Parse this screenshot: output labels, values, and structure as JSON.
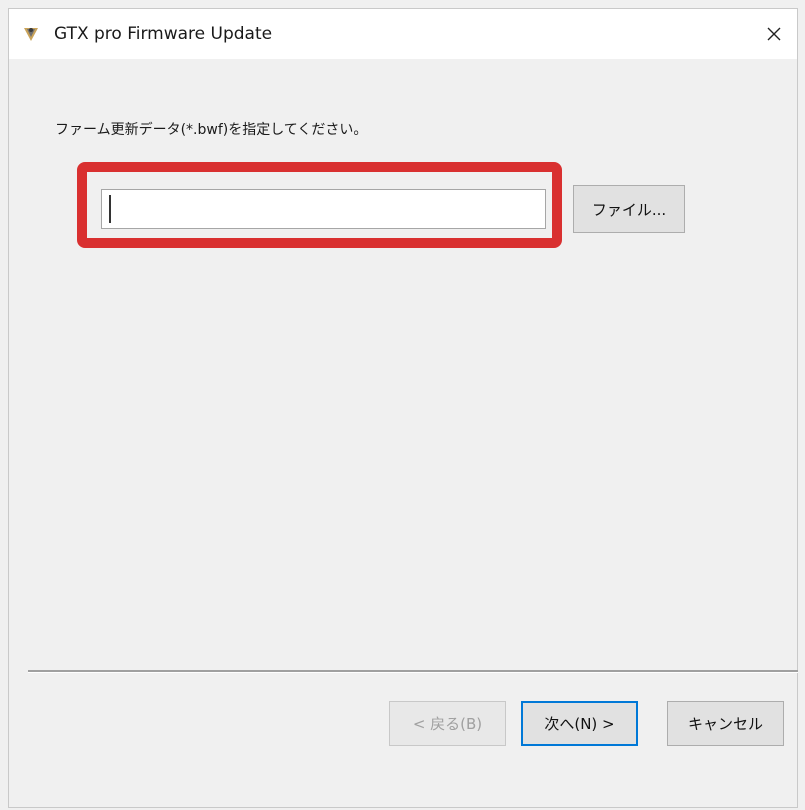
{
  "window": {
    "title": "GTX pro Firmware Update",
    "icon": "app-icon"
  },
  "content": {
    "instruction": "ファーム更新データ(*.bwf)を指定してください。",
    "file_path_value": "",
    "file_path_placeholder": "",
    "file_button_label": "ファイル..."
  },
  "footer": {
    "back_label": "< 戻る(B)",
    "next_label": "次へ(N) >",
    "cancel_label": "キャンセル"
  },
  "colors": {
    "highlight": "#d93030",
    "window_bg": "#f0f0f0",
    "default_button_border": "#0078d7"
  }
}
